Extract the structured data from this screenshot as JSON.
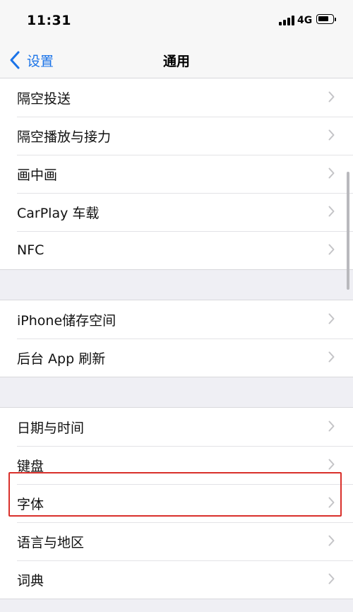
{
  "status_bar": {
    "time": "11:31",
    "network": "4G",
    "battery_level": 0.75
  },
  "nav": {
    "back_label": "设置",
    "title": "通用"
  },
  "groups": [
    {
      "items": [
        {
          "label": "隔空投送"
        },
        {
          "label": "隔空播放与接力"
        },
        {
          "label": "画中画"
        },
        {
          "label": "CarPlay 车载"
        },
        {
          "label": "NFC"
        }
      ]
    },
    {
      "items": [
        {
          "label": "iPhone储存空间"
        },
        {
          "label": "后台 App 刷新"
        }
      ]
    },
    {
      "items": [
        {
          "label": "日期与时间"
        },
        {
          "label": "键盘"
        },
        {
          "label": "字体"
        },
        {
          "label": "语言与地区"
        },
        {
          "label": "词典"
        }
      ]
    }
  ],
  "colors": {
    "accent": "#1a73e8",
    "highlight": "#d9302b",
    "background": "#efeff4"
  }
}
